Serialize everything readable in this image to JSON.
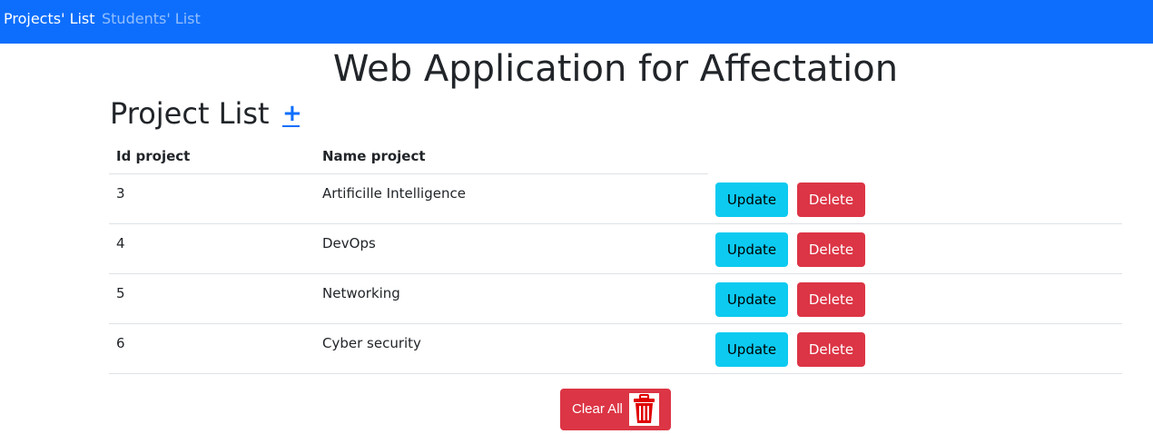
{
  "nav": {
    "items": [
      {
        "label": "Projects' List"
      },
      {
        "label": "Students' List"
      }
    ]
  },
  "page": {
    "title": "Web Application for Affectation",
    "section_title": "Project List",
    "add_symbol": "+"
  },
  "table": {
    "columns": [
      "Id project",
      "Name project"
    ],
    "rows": [
      {
        "id": "3",
        "name": "Artificille Intelligence",
        "update_label": "Update",
        "delete_label": "Delete"
      },
      {
        "id": "4",
        "name": "DevOps",
        "update_label": "Update",
        "delete_label": "Delete"
      },
      {
        "id": "5",
        "name": "Networking",
        "update_label": "Update",
        "delete_label": "Delete"
      },
      {
        "id": "6",
        "name": "Cyber security",
        "update_label": "Update",
        "delete_label": "Delete"
      }
    ]
  },
  "footer": {
    "clear_label": "Clear All",
    "clear_icon": "trash-icon"
  },
  "colors": {
    "navbar": "#0d6efd",
    "update": "#0dcaf0",
    "delete": "#dc3545",
    "trash_icon": "#e00000"
  }
}
